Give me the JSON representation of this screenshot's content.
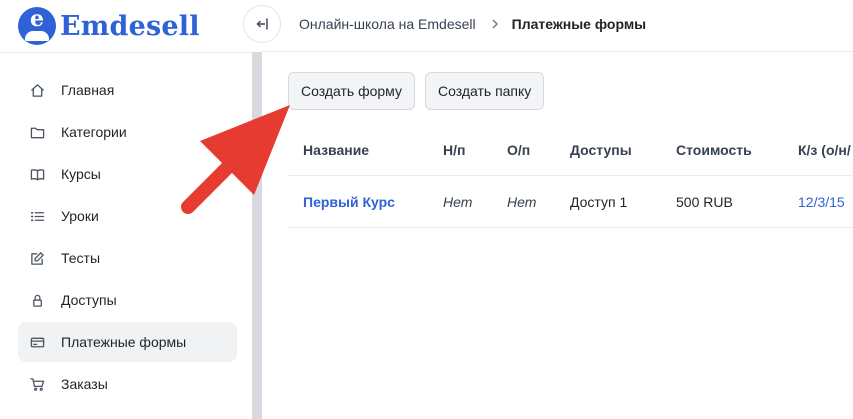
{
  "brand": {
    "name": "Emdesell",
    "logo_letter": "e"
  },
  "sidebar": {
    "items": [
      {
        "label": "Главная",
        "icon": "home-icon"
      },
      {
        "label": "Категории",
        "icon": "folder-icon"
      },
      {
        "label": "Курсы",
        "icon": "book-icon"
      },
      {
        "label": "Уроки",
        "icon": "list-icon"
      },
      {
        "label": "Тесты",
        "icon": "edit-icon"
      },
      {
        "label": "Доступы",
        "icon": "lock-icon"
      },
      {
        "label": "Платежные формы",
        "icon": "credit-card-icon",
        "active": true
      },
      {
        "label": "Заказы",
        "icon": "cart-icon"
      }
    ]
  },
  "header": {
    "breadcrumb": [
      {
        "label": "Онлайн-школа на Emdesell"
      },
      {
        "label": "Платежные формы"
      }
    ]
  },
  "toolbar": {
    "create_form_label": "Создать форму",
    "create_folder_label": "Создать папку"
  },
  "table": {
    "columns": [
      "Название",
      "Н/п",
      "О/п",
      "Доступы",
      "Стоимость",
      "К/з (о/н/"
    ],
    "rows": [
      {
        "name": "Первый Курс",
        "np": "Нет",
        "op": "Нет",
        "access": "Доступ 1",
        "price": "500 RUB",
        "kz": "12/3/15"
      }
    ]
  },
  "colors": {
    "accent": "#2f62d6",
    "annotation_arrow": "#e53b30",
    "active_bg": "#f1f2f4"
  }
}
